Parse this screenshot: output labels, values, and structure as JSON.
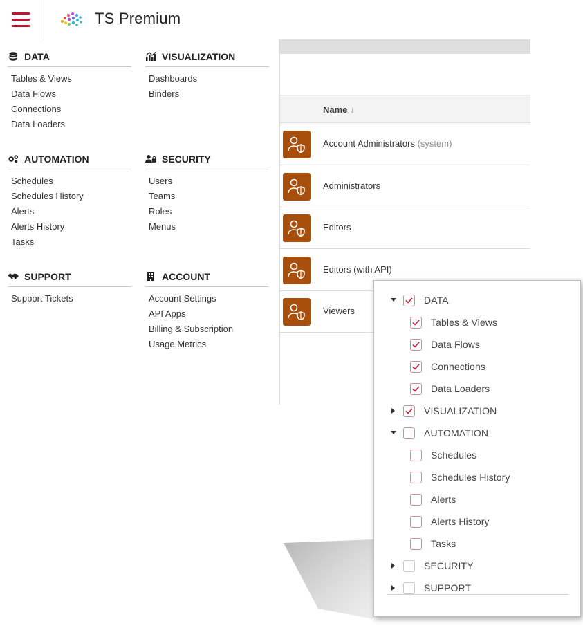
{
  "header": {
    "title": "TS Premium",
    "menu_icon": "hamburger-icon",
    "logo_icon": "dotted-sphere-logo"
  },
  "menu": {
    "data": {
      "title": "DATA",
      "icon": "database-icon",
      "items": [
        "Tables & Views",
        "Data Flows",
        "Connections",
        "Data Loaders"
      ]
    },
    "visualization": {
      "title": "VISUALIZATION",
      "icon": "chart-icon",
      "items": [
        "Dashboards",
        "Binders"
      ]
    },
    "automation": {
      "title": "AUTOMATION",
      "icon": "gears-icon",
      "items": [
        "Schedules",
        "Schedules History",
        "Alerts",
        "Alerts History",
        "Tasks"
      ]
    },
    "security": {
      "title": "SECURITY",
      "icon": "user-lock-icon",
      "items": [
        "Users",
        "Teams",
        "Roles",
        "Menus"
      ]
    },
    "support": {
      "title": "SUPPORT",
      "icon": "handshake-icon",
      "items": [
        "Support Tickets"
      ]
    },
    "account": {
      "title": "ACCOUNT",
      "icon": "building-icon",
      "items": [
        "Account Settings",
        "API Apps",
        "Billing & Subscription",
        "Usage Metrics"
      ]
    }
  },
  "table": {
    "column": "Name",
    "sort_icon": "arrow-down-icon",
    "rows": [
      {
        "name": "Account Administrators",
        "suffix": "(system)"
      },
      {
        "name": "Administrators",
        "suffix": ""
      },
      {
        "name": "Editors",
        "suffix": ""
      },
      {
        "name": "Editors (with API)",
        "suffix": ""
      },
      {
        "name": "Viewers",
        "suffix": ""
      }
    ]
  },
  "tree": {
    "items": [
      {
        "label": "DATA",
        "caret": "down",
        "checked": true
      },
      {
        "label": "Tables & Views",
        "checked": true
      },
      {
        "label": "Data Flows",
        "checked": true
      },
      {
        "label": "Connections",
        "checked": true
      },
      {
        "label": "Data Loaders",
        "checked": true
      },
      {
        "label": "VISUALIZATION",
        "caret": "right",
        "checked": true
      },
      {
        "label": "AUTOMATION",
        "caret": "down",
        "checked": false
      },
      {
        "label": "Schedules",
        "checked": false
      },
      {
        "label": "Schedules History",
        "checked": false
      },
      {
        "label": "Alerts",
        "checked": false
      },
      {
        "label": "Alerts History",
        "checked": false
      },
      {
        "label": "Tasks",
        "checked": false
      },
      {
        "label": "SECURITY",
        "caret": "right",
        "checked": false
      },
      {
        "label": "SUPPORT",
        "caret": "right",
        "checked": false
      }
    ]
  },
  "colors": {
    "accent": "#c31432",
    "avatar_bg": "#a84f0d",
    "checkbox_border": "#d28c96"
  }
}
